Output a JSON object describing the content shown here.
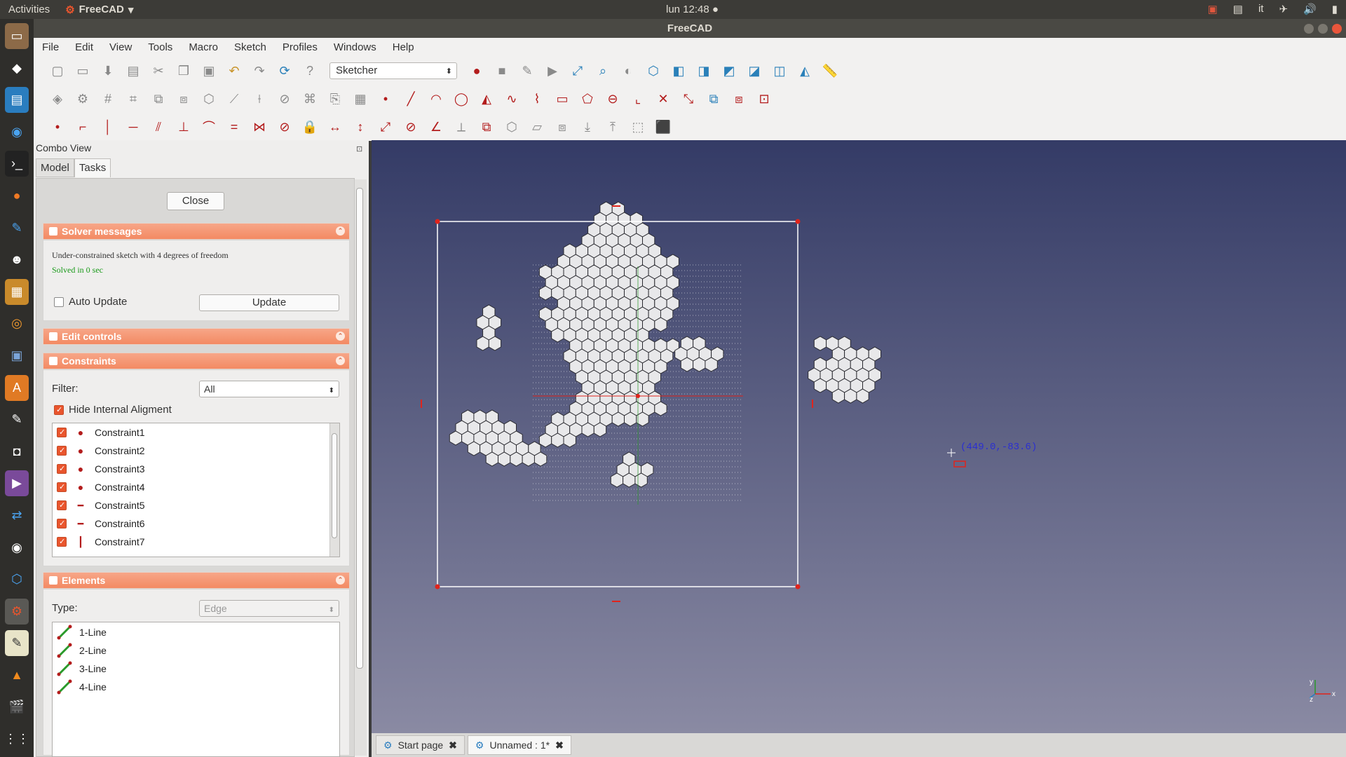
{
  "topbar": {
    "activities": "Activities",
    "app": "FreeCAD",
    "clock": "lun 12:48 ●",
    "lang": "it"
  },
  "window": {
    "title": "FreeCAD"
  },
  "menu": [
    "File",
    "Edit",
    "View",
    "Tools",
    "Macro",
    "Sketch",
    "Profiles",
    "Windows",
    "Help"
  ],
  "workbench": "Sketcher",
  "combo": {
    "title": "Combo View",
    "tabs": [
      "Model",
      "Tasks"
    ]
  },
  "tasks": {
    "close_label": "Close",
    "solver": {
      "title": "Solver messages",
      "msg": "Under-constrained sketch with 4 degrees of freedom",
      "solved": "Solved in 0 sec",
      "auto_update": "Auto Update",
      "update_btn": "Update"
    },
    "edit_controls": {
      "title": "Edit controls"
    },
    "constraints": {
      "title": "Constraints",
      "filter_label": "Filter:",
      "filter_value": "All",
      "hide_internal": "Hide Internal Aligment",
      "items": [
        {
          "label": "Constraint1",
          "sym": "●"
        },
        {
          "label": "Constraint2",
          "sym": "●"
        },
        {
          "label": "Constraint3",
          "sym": "●"
        },
        {
          "label": "Constraint4",
          "sym": "●"
        },
        {
          "label": "Constraint5",
          "sym": "━"
        },
        {
          "label": "Constraint6",
          "sym": "━"
        },
        {
          "label": "Constraint7",
          "sym": "┃"
        }
      ]
    },
    "elements": {
      "title": "Elements",
      "type_label": "Type:",
      "type_value": "Edge",
      "items": [
        "1-Line",
        "2-Line",
        "3-Line",
        "4-Line"
      ]
    }
  },
  "viewport": {
    "coords": "(449.0,-83.6)",
    "axis_labels": [
      "y",
      "z",
      "x"
    ],
    "colors": {
      "bg_top": "#343b66",
      "bg_bottom": "#8a8aa3",
      "construction": "#ffffff",
      "vertex": "#e0241c"
    }
  },
  "doc_tabs": [
    {
      "label": "Start page"
    },
    {
      "label": "Unnamed : 1*"
    }
  ]
}
